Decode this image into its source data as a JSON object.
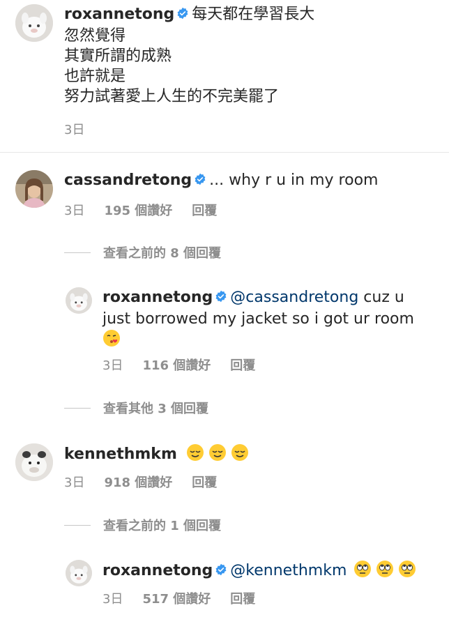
{
  "caption": {
    "username": "roxannetong",
    "lines": [
      "每天都在學習長大",
      "忽然覺得",
      "其實所謂的成熟",
      "也許就是",
      "努力試著愛上人生的不完美罷了"
    ],
    "time": "3日"
  },
  "comments": [
    {
      "username": "cassandretong",
      "text": "... why r u in my room",
      "time": "3日",
      "likes": "195 個讚好",
      "reply": "回覆",
      "view_more": "查看之前的 8 個回覆"
    },
    {
      "username": "roxannetong",
      "mention": "@cassandretong",
      "text_line1": " cuz u",
      "text_line2": "just borrowed my jacket so i got ur room",
      "emoji": "kissing-heart-emoji",
      "time": "3日",
      "likes": "116 個讚好",
      "reply": "回覆",
      "view_more": "查看其他 3 個回覆"
    },
    {
      "username": "kennethmkm",
      "emojis": [
        "relieved-emoji",
        "relieved-emoji",
        "relieved-emoji"
      ],
      "time": "3日",
      "likes": "918 個讚好",
      "reply": "回覆",
      "view_more": "查看之前的 1 個回覆"
    },
    {
      "username": "roxannetong",
      "mention": "@kennethmkm",
      "emojis": [
        "eye-roll-emoji",
        "eye-roll-emoji",
        "eye-roll-emoji"
      ],
      "time": "3日",
      "likes": "517 個讚好",
      "reply": "回覆"
    }
  ],
  "colors": {
    "text": "#262626",
    "muted": "#8e8e8e",
    "mention": "#00376b",
    "verified": "#3897f0"
  }
}
